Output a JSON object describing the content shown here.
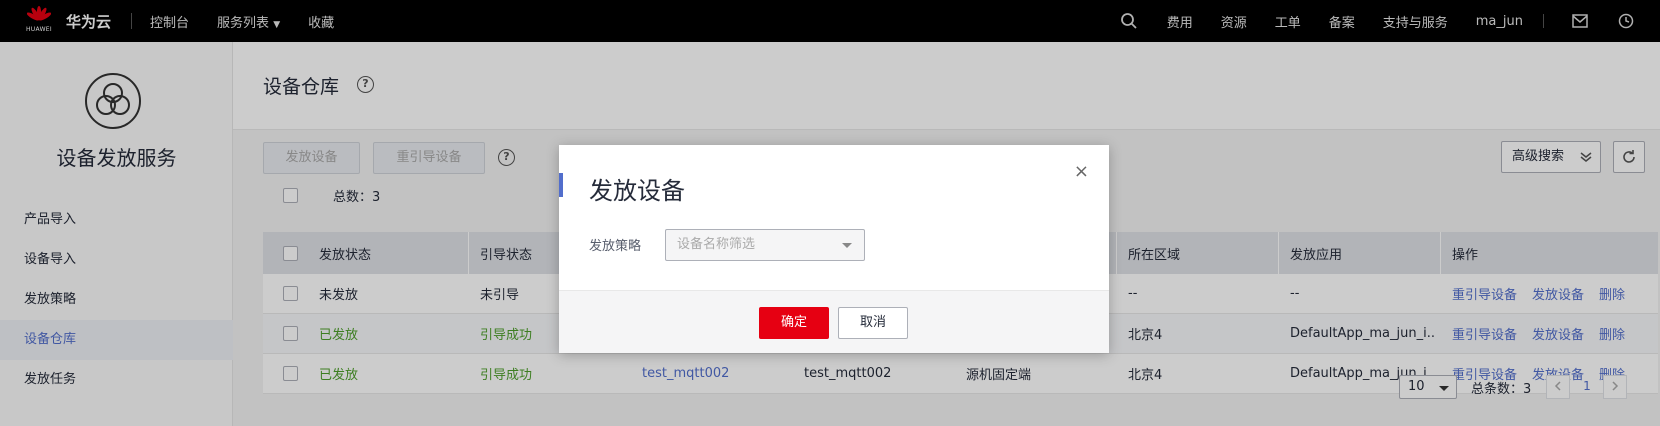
{
  "topbar": {
    "logo_text": "HUAWEI",
    "brand": "华为云",
    "nav": [
      "控制台",
      "服务列表",
      "收藏"
    ],
    "right_links": [
      "费用",
      "资源",
      "工单",
      "备案",
      "支持与服务",
      "ma_jun"
    ]
  },
  "sidebar": {
    "service_name": "设备发放服务",
    "items": [
      {
        "label": "产品导入"
      },
      {
        "label": "设备导入"
      },
      {
        "label": "发放策略"
      },
      {
        "label": "设备仓库"
      },
      {
        "label": "发放任务"
      }
    ],
    "active_index": 3
  },
  "page": {
    "title": "设备仓库",
    "toolbar": {
      "issue_button": "发放设备",
      "reguide_button": "重引导设备",
      "advanced_search": "高级搜索",
      "total_label": "总数：3"
    },
    "table": {
      "columns": [
        "发放状态",
        "引导状态",
        "",
        "",
        "",
        "所在区域",
        "发放应用",
        "操作"
      ],
      "rows": [
        {
          "issue_status": "未发放",
          "guide_status": "未引导",
          "device_name": "",
          "device_id": "",
          "type": "",
          "region": "--",
          "app": "--",
          "actions": [
            "重引导设备",
            "发放设备",
            "删除"
          ]
        },
        {
          "issue_status": "已发放",
          "guide_status": "引导成功",
          "device_name": "",
          "device_id": "",
          "type": "",
          "region": "北京4",
          "app": "DefaultApp_ma_jun_i...",
          "actions": [
            "重引导设备",
            "发放设备",
            "删除"
          ]
        },
        {
          "issue_status": "已发放",
          "guide_status": "引导成功",
          "device_name": "test_mqtt002",
          "device_id": "test_mqtt002",
          "type": "源机固定端",
          "region": "北京4",
          "app": "DefaultApp_ma_jun_i...",
          "actions": [
            "重引导设备",
            "发放设备",
            "删除"
          ]
        }
      ]
    },
    "pager": {
      "page_size": "10",
      "total": "总条数：3",
      "current_page": "1"
    }
  },
  "dialog": {
    "title": "发放设备",
    "close": "×",
    "field_label": "发放策略",
    "select_placeholder": "设备名称筛选",
    "ok": "确定",
    "cancel": "取消"
  },
  "colors": {
    "accent": "#526ecc",
    "primary_red": "#e60012",
    "success_green": "#4d9e2a"
  }
}
